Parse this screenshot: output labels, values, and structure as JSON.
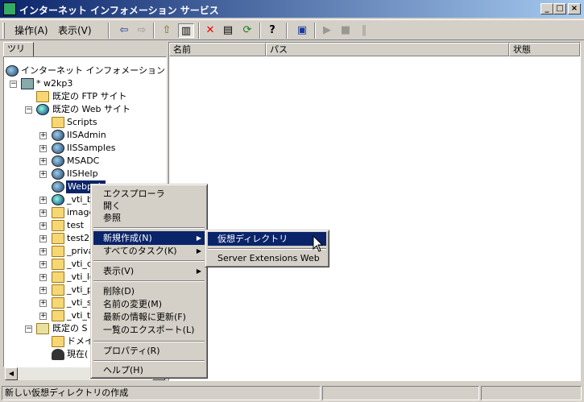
{
  "window": {
    "title": "インターネット インフォメーション サービス",
    "minimize": "_",
    "maximize": "□",
    "close": "×"
  },
  "menubar": {
    "action": "操作(A)",
    "view": "表示(V)"
  },
  "toolbar_glyphs": {
    "back": "⇦",
    "forward": "⇨",
    "up": "⇧",
    "panes": "▥",
    "delete": "✕",
    "properties": "▤",
    "refresh": "⟳",
    "help": "?",
    "computer": "▣",
    "play": "▶",
    "stop": "■",
    "pause": "‖"
  },
  "tabs": {
    "tree": "ツリー"
  },
  "tree": {
    "root": "インターネット インフォメーション サービス",
    "server": "* w2kp3",
    "ftp_site": "既定の FTP サイト",
    "web_site": "既定の Web サイト",
    "children": [
      "Scripts",
      "IISAdmin",
      "IISSamples",
      "MSADC",
      "IISHelp",
      "Webpub",
      "_vti_b",
      "image",
      "test",
      "test2",
      "_priva",
      "_vti_c",
      "_vti_lo",
      "_vti_p",
      "_vti_s",
      "_vti_t"
    ],
    "smtp": "既定の S",
    "domain": "ドメイ",
    "current": "現在("
  },
  "list": {
    "columns": [
      "名前",
      "パス",
      "状態"
    ]
  },
  "context_menu": {
    "items": [
      "エクスプローラ",
      "開く",
      "参照",
      "新規作成(N)",
      "すべてのタスク(K)",
      "表示(V)",
      "削除(D)",
      "名前の変更(M)",
      "最新の情報に更新(F)",
      "一覧のエクスポート(L)",
      "プロパティ(R)",
      "ヘルプ(H)"
    ],
    "submenu_arrow": "▶"
  },
  "submenu": {
    "items": [
      "仮想ディレクトリ",
      "Server Extensions Web"
    ]
  },
  "statusbar": {
    "text": "新しい仮想ディレクトリの作成"
  },
  "scroll": {
    "left": "◀",
    "right": "▶"
  }
}
